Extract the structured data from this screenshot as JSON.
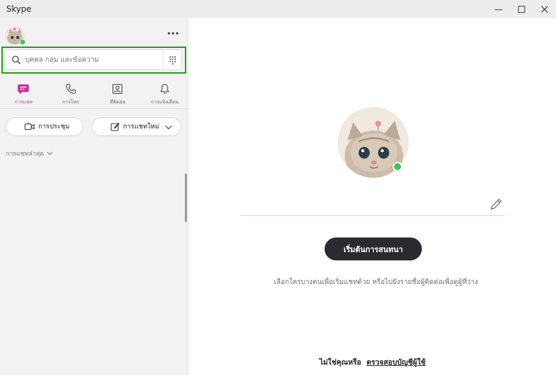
{
  "window": {
    "title": "Skype"
  },
  "sidebar": {
    "search": {
      "placeholder": "บุคคล กลุ่ม และข้อความ"
    },
    "tabs": [
      {
        "label": "การแชท",
        "icon": "chat-icon",
        "active": true
      },
      {
        "label": "การโทร",
        "icon": "phone-icon",
        "active": false
      },
      {
        "label": "ที่ติดต่อ",
        "icon": "contacts-icon",
        "active": false
      },
      {
        "label": "การแจ้งเตือน",
        "icon": "bell-icon",
        "active": false
      }
    ],
    "meet_now_label": "การประชุม",
    "new_chat_label": "การแชทใหม่",
    "recent_chats_label": "การแชทล่าสุด"
  },
  "main": {
    "start_button_label": "เริ่มต้นการสนทนา",
    "hint_text": "เลือกใครบางคนเพื่อเริ่มแชทด้วย หรือไปยังรายชื่อผู้ติดต่อเพื่อดูผู้ที่ว่าง",
    "not_you_text": "ไม่ใช่คุณหรือ",
    "check_account_link": "ตรวจสอบบัญชีผู้ใช้"
  },
  "colors": {
    "accent": "#c2389a",
    "presence": "#44c05e",
    "highlight_outline": "#1f9e1f",
    "start_button_bg": "#2a2a2f"
  }
}
